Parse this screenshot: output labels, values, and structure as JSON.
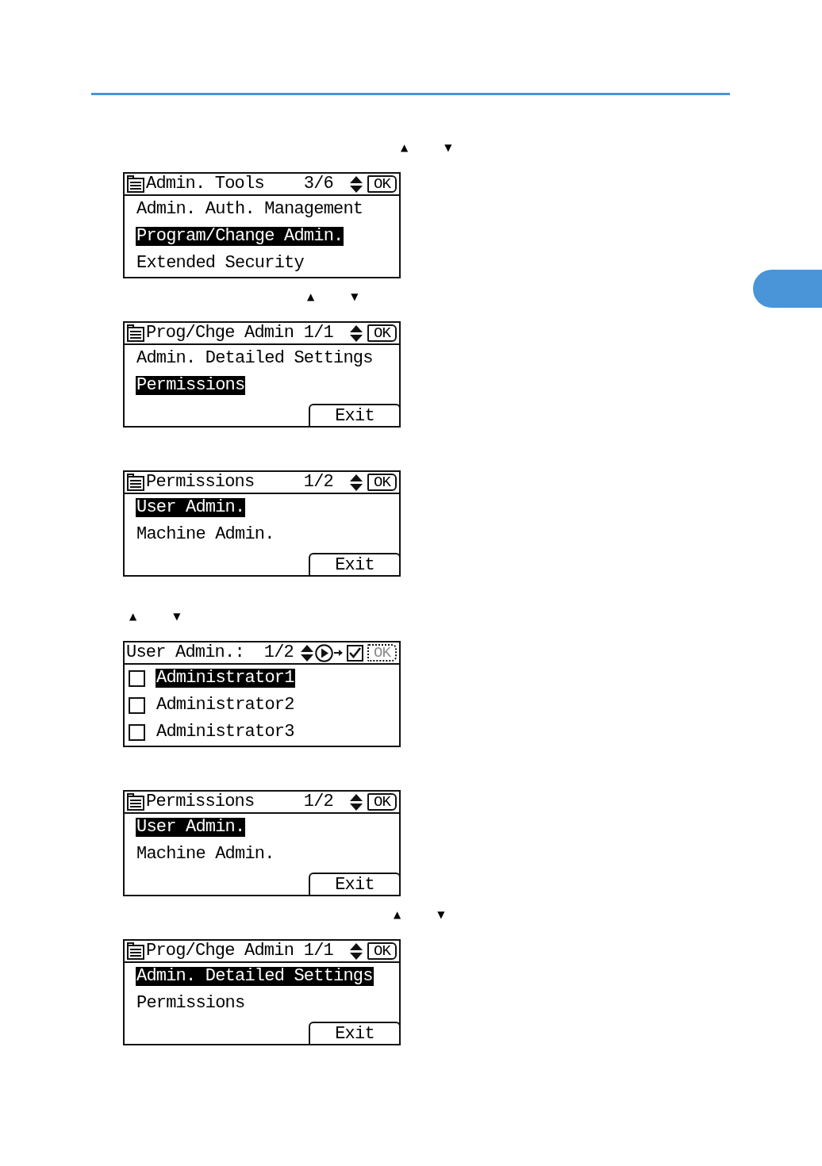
{
  "steps": [
    {
      "arrow_keys": [
        "▲",
        "▼"
      ],
      "screen": {
        "kind": "menu",
        "title": "Admin. Tools",
        "page": "3/6",
        "ok_key": {
          "label": "OK",
          "disabled": false
        },
        "items": [
          {
            "label": "Admin. Auth. Management",
            "selected": false
          },
          {
            "label": "Program/Change Admin.",
            "selected": true
          },
          {
            "label": "Extended Security",
            "selected": false
          }
        ]
      }
    },
    {
      "arrow_keys": [
        "▲",
        "▼"
      ],
      "screen": {
        "kind": "menu",
        "title": "Prog/Chge Admin",
        "page": "1/1",
        "ok_key": {
          "label": "OK",
          "disabled": false
        },
        "items": [
          {
            "label": "Admin. Detailed Settings",
            "selected": false
          },
          {
            "label": "Permissions",
            "selected": true
          }
        ],
        "soft_key": "Exit"
      }
    },
    {
      "screen": {
        "kind": "menu",
        "title": "Permissions",
        "page": "1/2",
        "ok_key": {
          "label": "OK",
          "disabled": false
        },
        "items": [
          {
            "label": "User Admin.",
            "selected": true
          },
          {
            "label": "Machine Admin.",
            "selected": false
          }
        ],
        "soft_key": "Exit"
      }
    },
    {
      "arrow_keys": [
        "▲",
        "▼"
      ],
      "screen": {
        "kind": "checklist",
        "title": "User Admin.:",
        "page": "1/2",
        "ok_key": {
          "label": "OK",
          "disabled": true
        },
        "items": [
          {
            "label": "Administrator1",
            "selected": true,
            "checked": false
          },
          {
            "label": "Administrator2",
            "selected": false,
            "checked": false
          },
          {
            "label": "Administrator3",
            "selected": false,
            "checked": false
          }
        ]
      }
    },
    {
      "screen": {
        "kind": "menu",
        "title": "Permissions",
        "page": "1/2",
        "ok_key": {
          "label": "OK",
          "disabled": false
        },
        "items": [
          {
            "label": "User Admin.",
            "selected": true
          },
          {
            "label": "Machine Admin.",
            "selected": false
          }
        ],
        "soft_key": "Exit"
      }
    },
    {
      "arrow_keys": [
        "▲",
        "▼"
      ],
      "screen": {
        "kind": "menu",
        "title": "Prog/Chge Admin",
        "page": "1/1",
        "ok_key": {
          "label": "OK",
          "disabled": false
        },
        "items": [
          {
            "label": "Admin. Detailed Settings",
            "selected": true
          },
          {
            "label": "Permissions",
            "selected": false
          }
        ],
        "soft_key": "Exit"
      }
    }
  ]
}
